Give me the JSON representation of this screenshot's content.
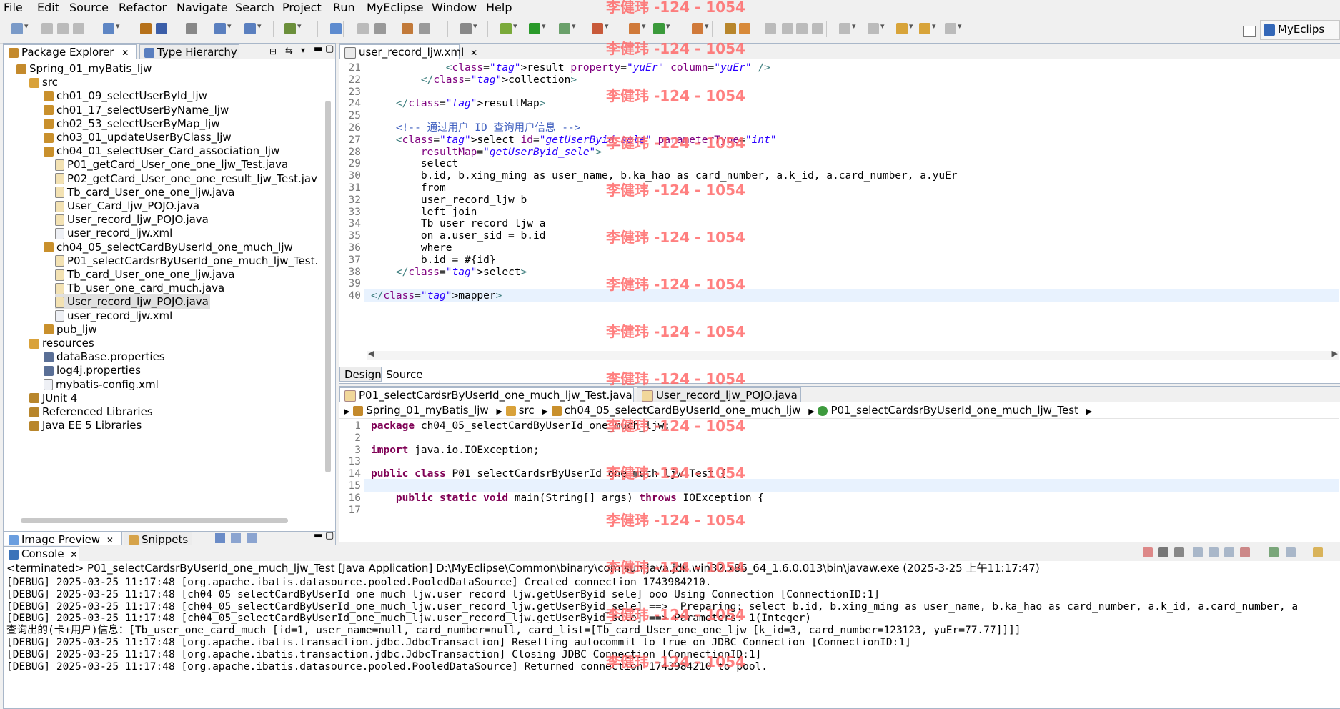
{
  "menu": [
    "File",
    "Edit",
    "Source",
    "Refactor",
    "Navigate",
    "Search",
    "Project",
    "Run",
    "MyEclipse",
    "Window",
    "Help"
  ],
  "perspective": "MyEclips",
  "watermark": "李健玮 -124 - 1054",
  "left_tabs": {
    "package_explorer": "Package Explorer",
    "type_hierarchy": "Type Hierarchy"
  },
  "tree": [
    {
      "label": "Spring_01_myBatis_ljw",
      "level": 0,
      "icon": "project-icon"
    },
    {
      "label": "src",
      "level": 1,
      "icon": "source-folder-icon"
    },
    {
      "label": "ch01_09_selectUserById_ljw",
      "level": 2,
      "icon": "package-icon"
    },
    {
      "label": "ch01_17_selectUserByName_ljw",
      "level": 2,
      "icon": "package-icon"
    },
    {
      "label": "ch02_53_selectUserByMap_ljw",
      "level": 2,
      "icon": "package-icon"
    },
    {
      "label": "ch03_01_updateUserByClass_ljw",
      "level": 2,
      "icon": "package-icon"
    },
    {
      "label": "ch04_01_selectUser_Card_association_ljw",
      "level": 2,
      "icon": "package-icon"
    },
    {
      "label": "P01_getCard_User_one_one_ljw_Test.java",
      "level": 3,
      "icon": "java-file-icon"
    },
    {
      "label": "P02_getCard_User_one_one_result_ljw_Test.jav",
      "level": 3,
      "icon": "java-file-icon"
    },
    {
      "label": "Tb_card_User_one_one_ljw.java",
      "level": 3,
      "icon": "java-file-icon"
    },
    {
      "label": "User_Card_ljw_POJO.java",
      "level": 3,
      "icon": "java-file-icon"
    },
    {
      "label": "User_record_ljw_POJO.java",
      "level": 3,
      "icon": "java-file-icon"
    },
    {
      "label": "user_record_ljw.xml",
      "level": 3,
      "icon": "xml-file-icon"
    },
    {
      "label": "ch04_05_selectCardByUserId_one_much_ljw",
      "level": 2,
      "icon": "package-icon"
    },
    {
      "label": "P01_selectCardsrByUserId_one_much_ljw_Test.",
      "level": 3,
      "icon": "java-file-icon"
    },
    {
      "label": "Tb_card_User_one_one_ljw.java",
      "level": 3,
      "icon": "java-file-icon"
    },
    {
      "label": "Tb_user_one_card_much.java",
      "level": 3,
      "icon": "java-file-icon"
    },
    {
      "label": "User_record_ljw_POJO.java",
      "level": 3,
      "icon": "java-file-icon",
      "selected": true
    },
    {
      "label": "user_record_ljw.xml",
      "level": 3,
      "icon": "xml-file-icon"
    },
    {
      "label": "pub_ljw",
      "level": 2,
      "icon": "package-icon"
    },
    {
      "label": "resources",
      "level": 1,
      "icon": "source-folder-icon"
    },
    {
      "label": "dataBase.properties",
      "level": 2,
      "icon": "properties-file-icon"
    },
    {
      "label": "log4j.properties",
      "level": 2,
      "icon": "properties-file-icon"
    },
    {
      "label": "mybatis-config.xml",
      "level": 2,
      "icon": "xml-file-icon"
    },
    {
      "label": "JUnit 4",
      "level": 1,
      "icon": "library-icon"
    },
    {
      "label": "Referenced Libraries",
      "level": 1,
      "icon": "library-icon"
    },
    {
      "label": "Java EE 5 Libraries",
      "level": 1,
      "icon": "library-icon"
    }
  ],
  "bottom_left_tabs": {
    "image_preview": "Image Preview",
    "snippets": "Snippets"
  },
  "xml_editor": {
    "tab": "user_record_ljw.xml",
    "lines": [
      {
        "n": "21",
        "text": "            <result property=\"yuEr\" column=\"yuEr\" />"
      },
      {
        "n": "22",
        "text": "        </collection>"
      },
      {
        "n": "23",
        "text": ""
      },
      {
        "n": "24",
        "text": "    </resultMap>"
      },
      {
        "n": "25",
        "text": ""
      },
      {
        "n": "26",
        "text": "    <!-- 通过用户 ID 查询用户信息 -->"
      },
      {
        "n": "27",
        "text": "    <select id=\"getUserByid_sele\" parameterType=\"int\""
      },
      {
        "n": "28",
        "text": "        resultMap=\"getUserByid_sele\">"
      },
      {
        "n": "29",
        "text": "        select"
      },
      {
        "n": "30",
        "text": "        b.id, b.xing_ming as user_name, b.ka_hao as card_number, a.k_id, a.card_number, a.yuEr"
      },
      {
        "n": "31",
        "text": "        from"
      },
      {
        "n": "32",
        "text": "        user_record_ljw b"
      },
      {
        "n": "33",
        "text": "        left join"
      },
      {
        "n": "34",
        "text": "        Tb_user_record_ljw a"
      },
      {
        "n": "35",
        "text": "        on a.user_sid = b.id"
      },
      {
        "n": "36",
        "text": "        where"
      },
      {
        "n": "37",
        "text": "        b.id = #{id}"
      },
      {
        "n": "38",
        "text": "    </select>"
      },
      {
        "n": "39",
        "text": ""
      },
      {
        "n": "40",
        "text": "</mapper>"
      }
    ],
    "design_tab": "Design",
    "source_tab": "Source"
  },
  "java_editor": {
    "tabs": [
      "P01_selectCardsrByUserId_one_much_ljw_Test.java",
      "User_record_ljw_POJO.java"
    ],
    "breadcrumb": [
      "Spring_01_myBatis_ljw",
      "src",
      "ch04_05_selectCardByUserId_one_much_ljw",
      "P01_selectCardsrByUserId_one_much_ljw_Test"
    ],
    "lines": [
      {
        "n": "1",
        "text": "package ch04_05_selectCardByUserId_one_much_ljw;"
      },
      {
        "n": "2",
        "text": ""
      },
      {
        "n": "3",
        "text": "import java.io.IOException;"
      },
      {
        "n": "13",
        "text": ""
      },
      {
        "n": "14",
        "text": "public class P01_selectCardsrByUserId_one_much_ljw_Test {"
      },
      {
        "n": "15",
        "text": ""
      },
      {
        "n": "16",
        "text": "    public static void main(String[] args) throws IOException {"
      },
      {
        "n": "17",
        "text": ""
      }
    ]
  },
  "console": {
    "tab": "Console",
    "header": "<terminated> P01_selectCardsrByUserId_one_much_ljw_Test [Java Application] D:\\MyEclipse\\Common\\binary\\com.sun.java.jdk.win32.x86_64_1.6.0.013\\bin\\javaw.exe (2025-3-25 上午11:17:47)",
    "lines": [
      "[DEBUG] 2025-03-25 11:17:48 [org.apache.ibatis.datasource.pooled.PooledDataSource] Created connection 1743984210.",
      "[DEBUG] 2025-03-25 11:17:48 [ch04_05_selectCardByUserId_one_much_ljw.user_record_ljw.getUserByid_sele] ooo Using Connection [ConnectionID:1]",
      "[DEBUG] 2025-03-25 11:17:48 [ch04_05_selectCardByUserId_one_much_ljw.user_record_ljw.getUserByid_sele] ==>  Preparing: select b.id, b.xing_ming as user_name, b.ka_hao as card_number, a.k_id, a.card_number, a",
      "[DEBUG] 2025-03-25 11:17:48 [ch04_05_selectCardByUserId_one_much_ljw.user_record_ljw.getUserByid_sele] ==> Parameters: 1(Integer)",
      "查询出的(卡+用户)信息：[Tb_user_one_card_much [id=1, user_name=null, card_number=null, card_list=[Tb_card_User_one_one_ljw [k_id=3, card_number=123123, yuEr=77.77]]]]",
      "[DEBUG] 2025-03-25 11:17:48 [org.apache.ibatis.transaction.jdbc.JdbcTransaction] Resetting autocommit to true on JDBC Connection [ConnectionID:1]",
      "[DEBUG] 2025-03-25 11:17:48 [org.apache.ibatis.transaction.jdbc.JdbcTransaction] Closing JDBC Connection [ConnectionID:1]",
      "[DEBUG] 2025-03-25 11:17:48 [org.apache.ibatis.datasource.pooled.PooledDataSource] Returned connection 1743984210 to pool."
    ]
  },
  "colors": {
    "xml_tag": "#3f7f7f",
    "xml_attr": "#7f007f",
    "xml_value": "#2a00ff",
    "comment": "#3f5fbf",
    "keyword": "#7f0055",
    "watermark": "#ff6a6a",
    "selection": "#e8f2fe"
  }
}
